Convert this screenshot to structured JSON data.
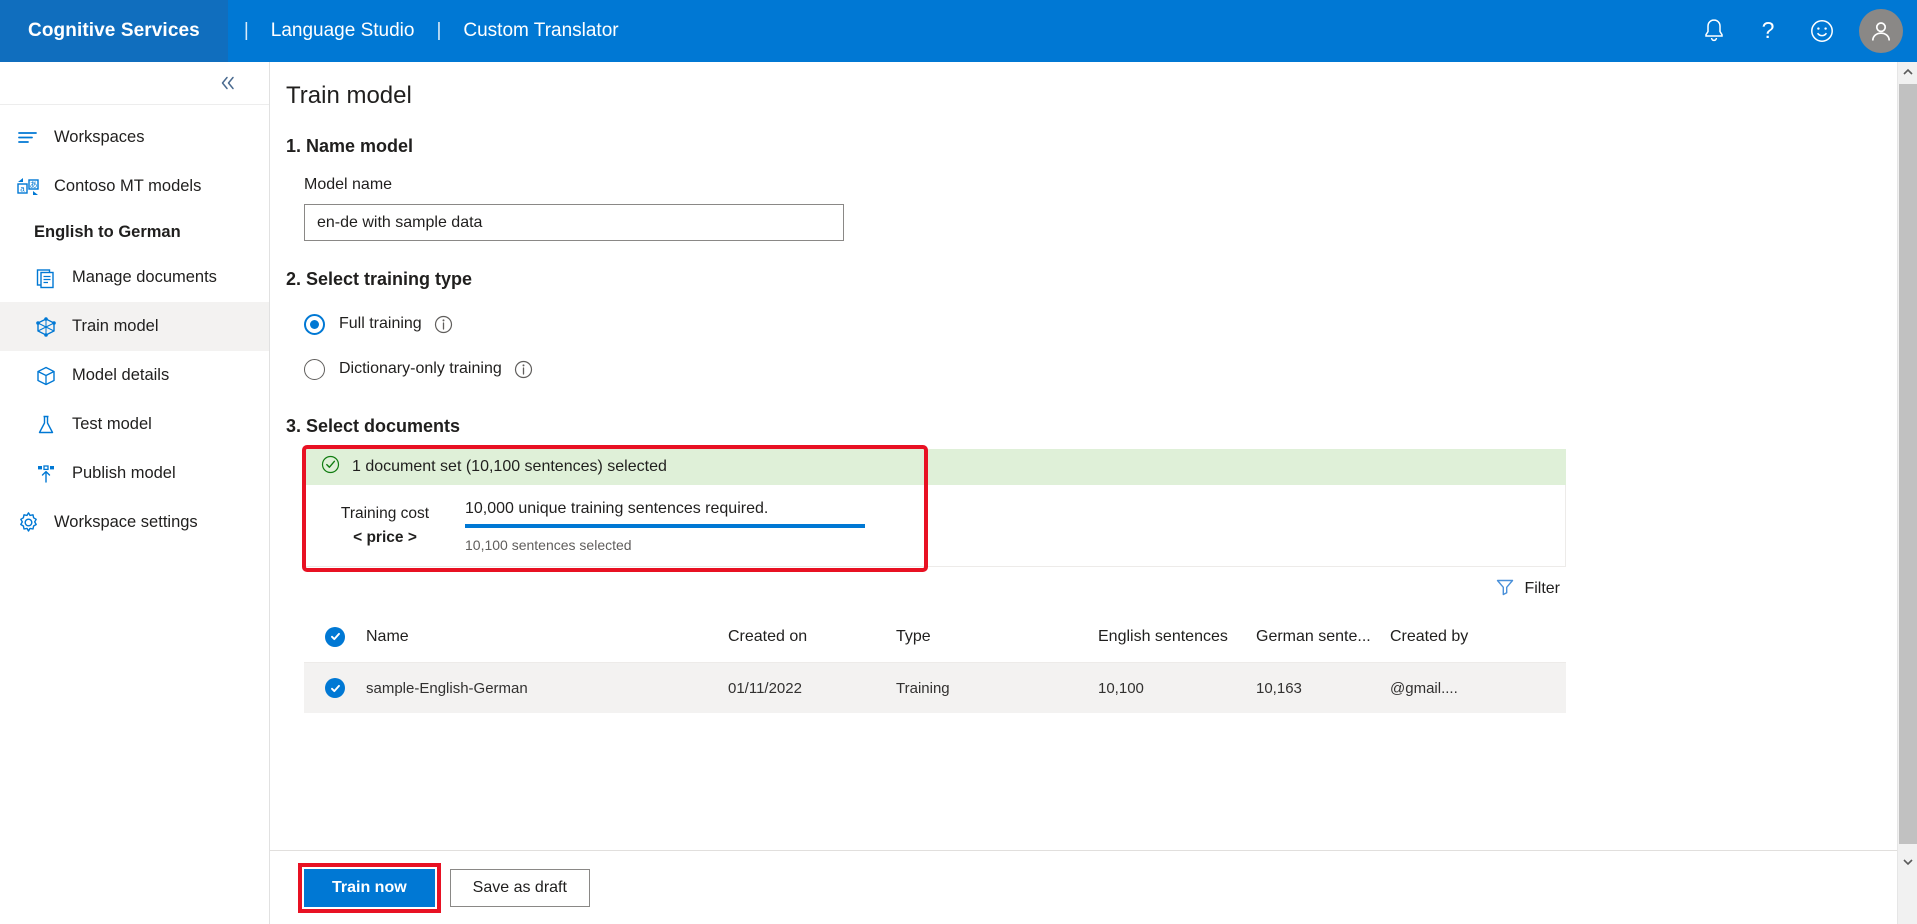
{
  "header": {
    "brand": "Cognitive Services",
    "divider": "|",
    "links": [
      "Language Studio",
      "Custom Translator"
    ],
    "icons": [
      "bell-icon",
      "help-icon",
      "feedback-smiley-icon",
      "account-avatar"
    ],
    "brand_color": "#0078d4",
    "brand_block_color": "#106ebe"
  },
  "sidebar": {
    "collapse_icon": "chevron-double-left-icon",
    "items": [
      {
        "label": "Workspaces",
        "icon": "workspaces-icon",
        "active": false
      },
      {
        "label": "Contoso MT models",
        "icon": "translate-models-icon",
        "active": false
      }
    ],
    "group_label": "English to German",
    "sub_items": [
      {
        "label": "Manage documents",
        "icon": "document-icon",
        "active": false
      },
      {
        "label": "Train model",
        "icon": "train-model-icon",
        "active": true
      },
      {
        "label": "Model details",
        "icon": "package-icon",
        "active": false
      },
      {
        "label": "Test model",
        "icon": "flask-icon",
        "active": false
      },
      {
        "label": "Publish model",
        "icon": "publish-icon",
        "active": false
      }
    ],
    "settings": {
      "label": "Workspace settings",
      "icon": "gear-icon"
    }
  },
  "main": {
    "page_title": "Train model",
    "step1": {
      "heading": "1. Name model",
      "field_label": "Model name",
      "input_value": "en-de with sample data",
      "input_placeholder": "Model name"
    },
    "step2": {
      "heading": "2. Select training type",
      "options": [
        {
          "label": "Full training",
          "selected": true,
          "info_icon": "info-icon"
        },
        {
          "label": "Dictionary-only training",
          "selected": false,
          "info_icon": "info-icon"
        }
      ]
    },
    "step3": {
      "heading": "3. Select documents",
      "banner": {
        "icon": "check-circle-icon",
        "text": "1 document set (10,100 sentences) selected",
        "background": "#dff0d8",
        "icon_color": "#107c10"
      },
      "cost": {
        "label": "Training cost",
        "value": "< price >",
        "required_text": "10,000 unique training sentences required.",
        "selected_text": "10,100 sentences selected",
        "progress_percent": 100,
        "progress_color": "#0078d4"
      },
      "filter": {
        "label": "Filter",
        "icon": "filter-funnel-icon"
      },
      "table": {
        "select_all_icon": "checkbox-checked-icon",
        "columns": [
          "Name",
          "Created on",
          "Type",
          "English sentences",
          "German sente...",
          "Created by"
        ],
        "rows": [
          {
            "selected": true,
            "name": "sample-English-German",
            "created_on": "01/11/2022",
            "type": "Training",
            "english_sentences": "10,100",
            "german_sentences": "10,163",
            "created_by": "@gmail...."
          }
        ]
      }
    },
    "footer": {
      "primary_button": "Train now",
      "secondary_button": "Save as draft",
      "highlight_color": "#e81123"
    }
  }
}
